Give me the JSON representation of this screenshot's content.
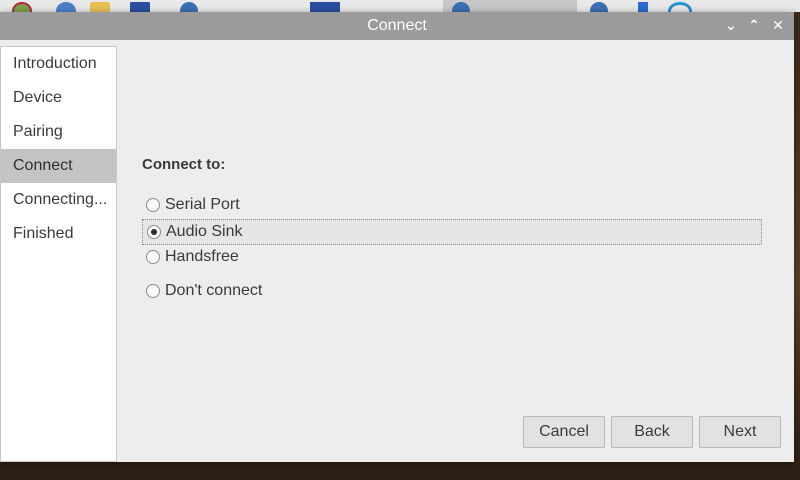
{
  "window": {
    "title": "Connect",
    "controls": {
      "minimize": "⌄",
      "maximize": "⌃",
      "close": "✕"
    }
  },
  "sidebar": {
    "items": [
      {
        "label": "Introduction",
        "active": false
      },
      {
        "label": "Device",
        "active": false
      },
      {
        "label": "Pairing",
        "active": false
      },
      {
        "label": "Connect",
        "active": true
      },
      {
        "label": "Connecting...",
        "active": false
      },
      {
        "label": "Finished",
        "active": false
      }
    ]
  },
  "main": {
    "connect_label": "Connect to:",
    "options": [
      {
        "label": "Serial Port",
        "checked": false
      },
      {
        "label": "Audio Sink",
        "checked": true
      },
      {
        "label": "Handsfree",
        "checked": false
      },
      {
        "label": "Don't connect",
        "checked": false
      }
    ]
  },
  "buttons": {
    "cancel": "Cancel",
    "back": "Back",
    "next": "Next"
  },
  "taskbar": {
    "icons": [
      "raspberry-pi-menu-icon",
      "web-browser-icon",
      "file-manager-icon",
      "terminal-icon",
      "bluetooth-app-icon",
      "bluetooth-icon",
      "wifi-icon"
    ]
  }
}
